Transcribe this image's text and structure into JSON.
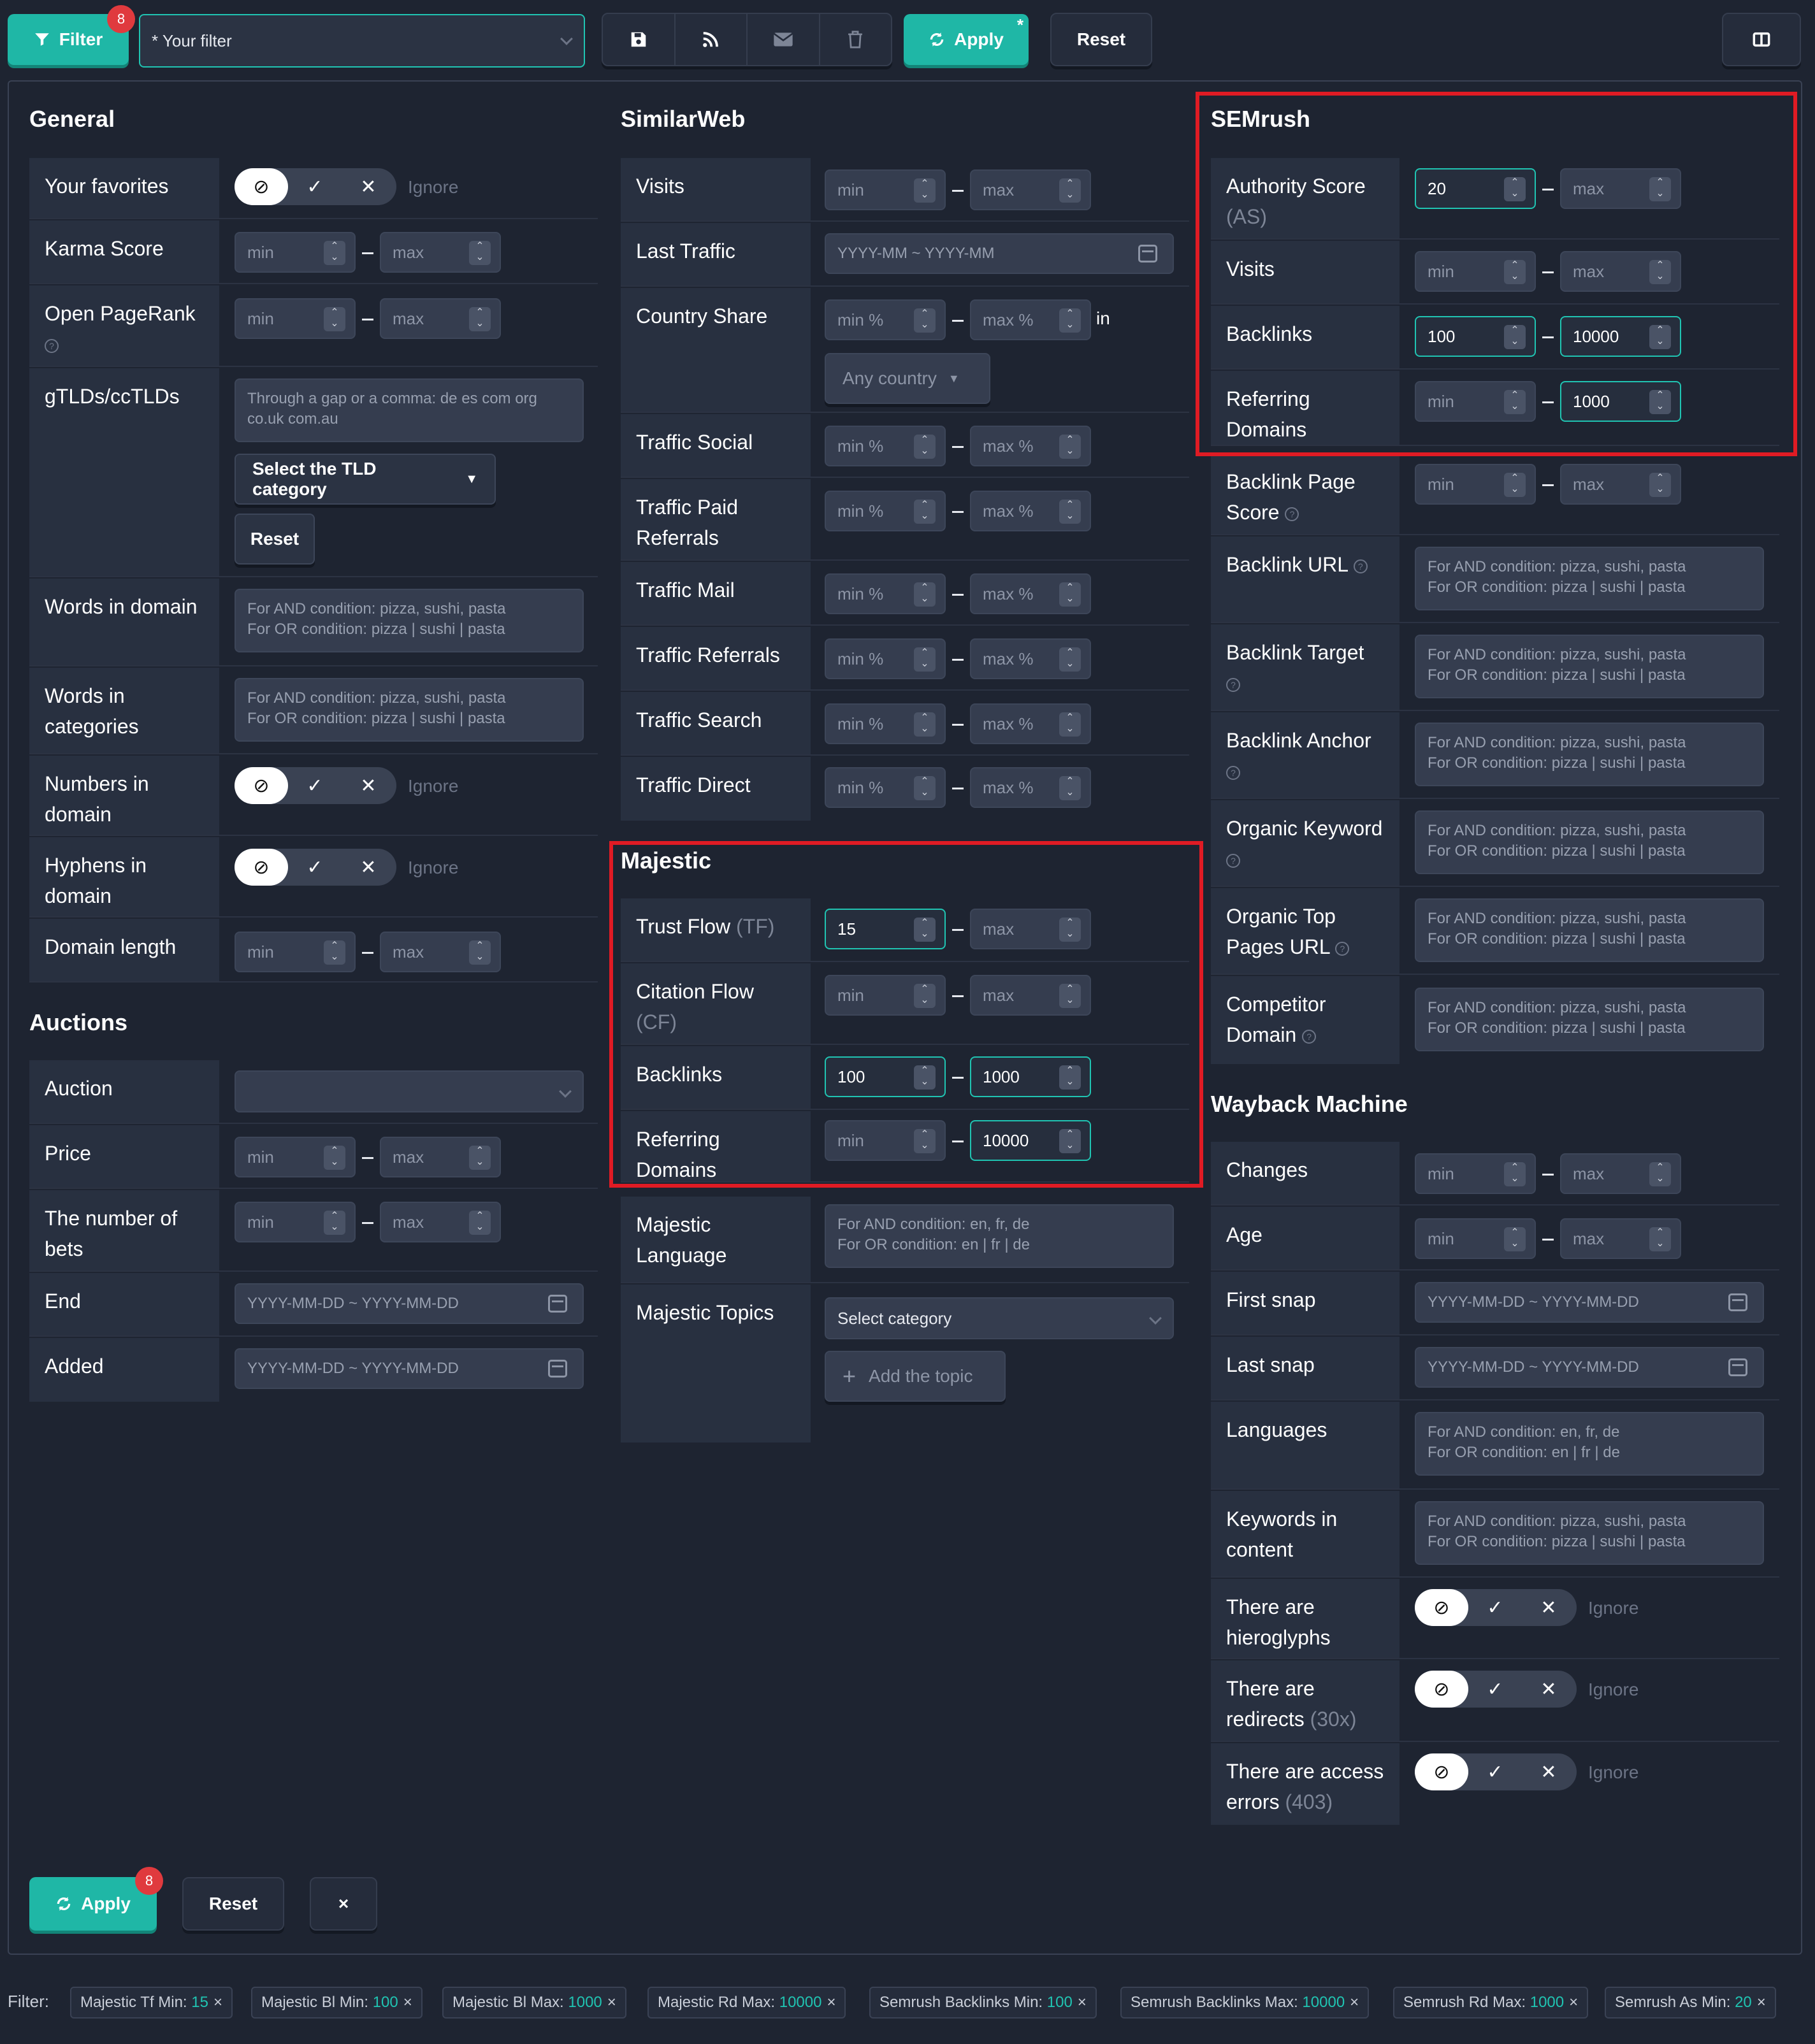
{
  "topbar": {
    "filter_label": "Filter",
    "filter_badge": "8",
    "filter_select_value": "* Your filter",
    "apply_label": "Apply",
    "apply_mark": "*",
    "reset_label": "Reset"
  },
  "placeholders": {
    "min": "min",
    "max": "max",
    "min_pct": "min %",
    "max_pct": "max %",
    "date": "YYYY-MM-DD ~ YYYY-MM-DD",
    "month": "YYYY-MM ~ YYYY-MM",
    "ignore": "Ignore",
    "and_or_food": "For AND condition: pizza, sushi, pasta\nFor OR condition: pizza | sushi | pasta",
    "and_or_lang": "For AND condition: en, fr, de\nFor OR condition: en | fr | de"
  },
  "general": {
    "title": "General",
    "favorites": "Your favorites",
    "karma": "Karma Score",
    "pagerank": "Open PageRank",
    "tld": "gTLDs/ccTLDs",
    "tld_placeholder": "Through a gap or a comma: de es com org\nco.uk com.au",
    "tld_category": "Select the TLD category",
    "tld_reset": "Reset",
    "words_domain": "Words in domain",
    "words_categories": "Words in categories",
    "numbers_domain": "Numbers in domain",
    "hyphens_domain": "Hyphens in domain",
    "domain_length": "Domain length"
  },
  "auctions": {
    "title": "Auctions",
    "auction": "Auction",
    "price": "Price",
    "bets": "The number of bets",
    "end": "End",
    "added": "Added"
  },
  "similarweb": {
    "title": "SimilarWeb",
    "visits": "Visits",
    "last_traffic": "Last Traffic",
    "country_share": "Country Share",
    "in": "in",
    "any_country": "Any country",
    "social": "Traffic Social",
    "paid_1": "Traffic Paid",
    "paid_2": "Referrals",
    "mail": "Traffic Mail",
    "referrals": "Traffic Referrals",
    "search": "Traffic Search",
    "direct": "Traffic Direct"
  },
  "majestic": {
    "title": "Majestic",
    "tf": "Trust Flow",
    "tf_abbr": "(TF)",
    "tf_min": "15",
    "cf": "Citation Flow",
    "cf_abbr": "(CF)",
    "backlinks": "Backlinks",
    "backlinks_min": "100",
    "backlinks_max": "1000",
    "rd_1": "Referring",
    "rd_2": "Domains",
    "rd_max": "10000",
    "lang_1": "Majestic",
    "lang_2": "Language",
    "topics": "Majestic Topics",
    "select_category": "Select category",
    "add_topic": "Add the topic"
  },
  "semrush": {
    "title": "SEMrush",
    "as_1": "Authority Score",
    "as_2": "(AS)",
    "as_min": "20",
    "visits": "Visits",
    "backlinks": "Backlinks",
    "backlinks_min": "100",
    "backlinks_max": "10000",
    "rd_1": "Referring",
    "rd_2": "Domains",
    "rd_max": "1000",
    "bps_1": "Backlink Page",
    "bps_2": "Score",
    "backlink_url": "Backlink URL",
    "backlink_target": "Backlink Target",
    "backlink_anchor": "Backlink Anchor",
    "organic_keyword": "Organic Keyword",
    "otp_1": "Organic Top",
    "otp_2": "Pages URL",
    "comp_1": "Competitor",
    "comp_2": "Domain"
  },
  "wayback": {
    "title": "Wayback Machine",
    "changes": "Changes",
    "age": "Age",
    "first_snap": "First snap",
    "last_snap": "Last snap",
    "languages": "Languages",
    "kw_1": "Keywords in",
    "kw_2": "content",
    "hiero_1": "There are",
    "hiero_2": "hieroglyphs",
    "redir_1": "There are",
    "redir_2": "redirects",
    "redir_abbr": "(30x)",
    "access_1": "There are access",
    "access_2": "errors",
    "access_abbr": "(403)"
  },
  "footer": {
    "apply": "Apply",
    "badge": "8",
    "reset": "Reset",
    "close": "×",
    "filter_label": "Filter:",
    "chips": [
      {
        "k": "Majestic Tf Min:",
        "v": "15"
      },
      {
        "k": "Majestic Bl Min:",
        "v": "100"
      },
      {
        "k": "Majestic Bl Max:",
        "v": "1000"
      },
      {
        "k": "Majestic Rd Max:",
        "v": "10000"
      },
      {
        "k": "Semrush Backlinks Min:",
        "v": "100"
      },
      {
        "k": "Semrush Backlinks Max:",
        "v": "10000"
      },
      {
        "k": "Semrush Rd Max:",
        "v": "1000"
      },
      {
        "k": "Semrush As Min:",
        "v": "20"
      }
    ]
  },
  "colors": {
    "accent": "#1fb7a6",
    "badge": "#e03a3e",
    "highlight": "#e01b24",
    "bg": "#1e2431"
  },
  "icons": [
    "filter-icon",
    "save-icon",
    "rss-icon",
    "mail-icon",
    "trash-icon",
    "refresh-icon",
    "layout-icon",
    "calendar-icon",
    "plus-icon",
    "ban-icon",
    "check-icon",
    "close-icon"
  ]
}
